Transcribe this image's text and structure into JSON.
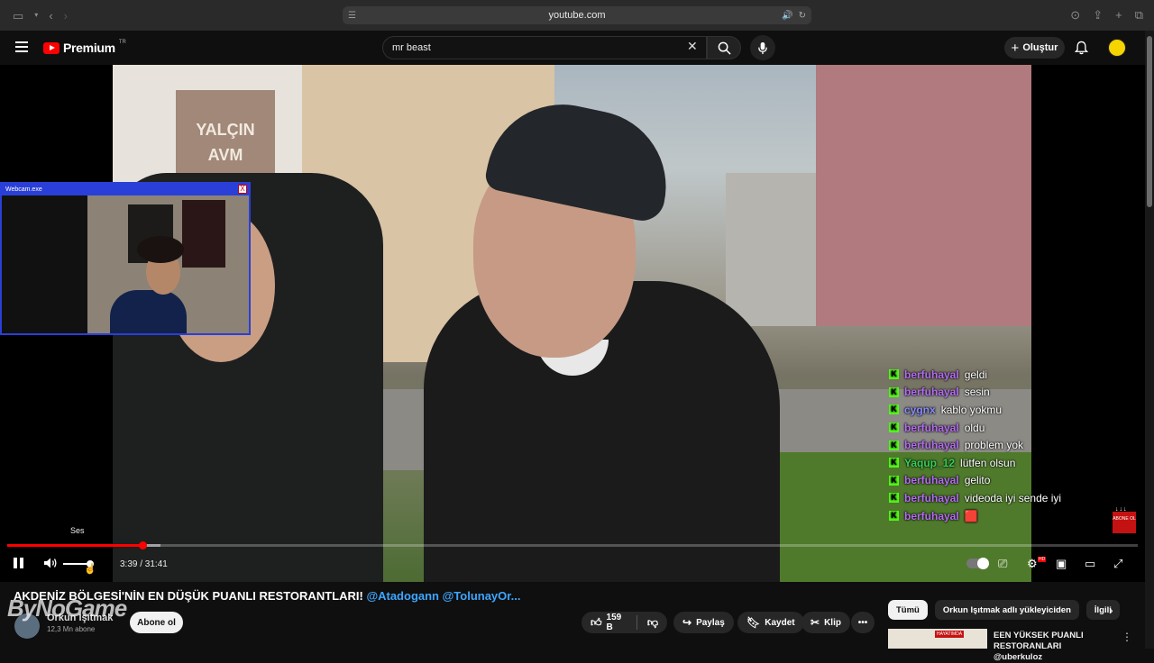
{
  "browser": {
    "url": "youtube.com"
  },
  "header": {
    "logo_text": "Premium",
    "region": "TR",
    "search_value": "mr beast",
    "create_label": "Oluştur"
  },
  "video": {
    "sign_text_line1": "YALÇIN",
    "sign_text_line2": "AVM",
    "progress_fraction": 0.1196,
    "volume_tooltip": "Ses",
    "current_time": "3:39",
    "duration": "31:41",
    "time_display": "3:39 / 31:41"
  },
  "webcam": {
    "title": "Webcam.exe",
    "close_label": "X"
  },
  "chat": [
    {
      "user": "berfuhayal",
      "message": "geldi",
      "color": "#b46cf0"
    },
    {
      "user": "berfuhayal",
      "message": "sesin",
      "color": "#b46cf0"
    },
    {
      "user": "cygnx",
      "message": "kablo yokmu",
      "color": "#8b8bff"
    },
    {
      "user": "berfuhayal",
      "message": "oldu",
      "color": "#b46cf0"
    },
    {
      "user": "berfuhayal",
      "message": "problem yok",
      "color": "#b46cf0"
    },
    {
      "user": "Yaqup_12",
      "message": "lütfen olsun",
      "color": "#34d058"
    },
    {
      "user": "berfuhayal",
      "message": "gelito",
      "color": "#b46cf0"
    },
    {
      "user": "berfuhayal",
      "message": "videoda iyi sende iyi",
      "color": "#b46cf0"
    },
    {
      "user": "berfuhayal",
      "message": "🟥",
      "color": "#b46cf0"
    }
  ],
  "kick_letter": "K",
  "abone_badge": "ABONE OL",
  "info": {
    "title": "AKDENİZ BÖLGESİ'NİN EN DÜŞÜK PUANLI RESTORANTLARI!",
    "title_tags": "@Atadogann @TolunayOr...",
    "watermark": "ByNoGame",
    "channel_name": "Orkun Işıtmak",
    "channel_subs": "12,3 Mn abone",
    "subscribe_label": "Abone ol",
    "likes": "159 B",
    "share_label": "Paylaş",
    "save_label": "Kaydet",
    "clip_label": "Klip"
  },
  "sidebar": {
    "chips": [
      "Tümü",
      "Orkun Işıtmak adlı yükleyiciden",
      "İlgili"
    ],
    "rec_title": "EEN YÜKSEK PUANLI RESTORANLARI @uberkuloz",
    "rec_badge": "HAYATIMDA"
  }
}
